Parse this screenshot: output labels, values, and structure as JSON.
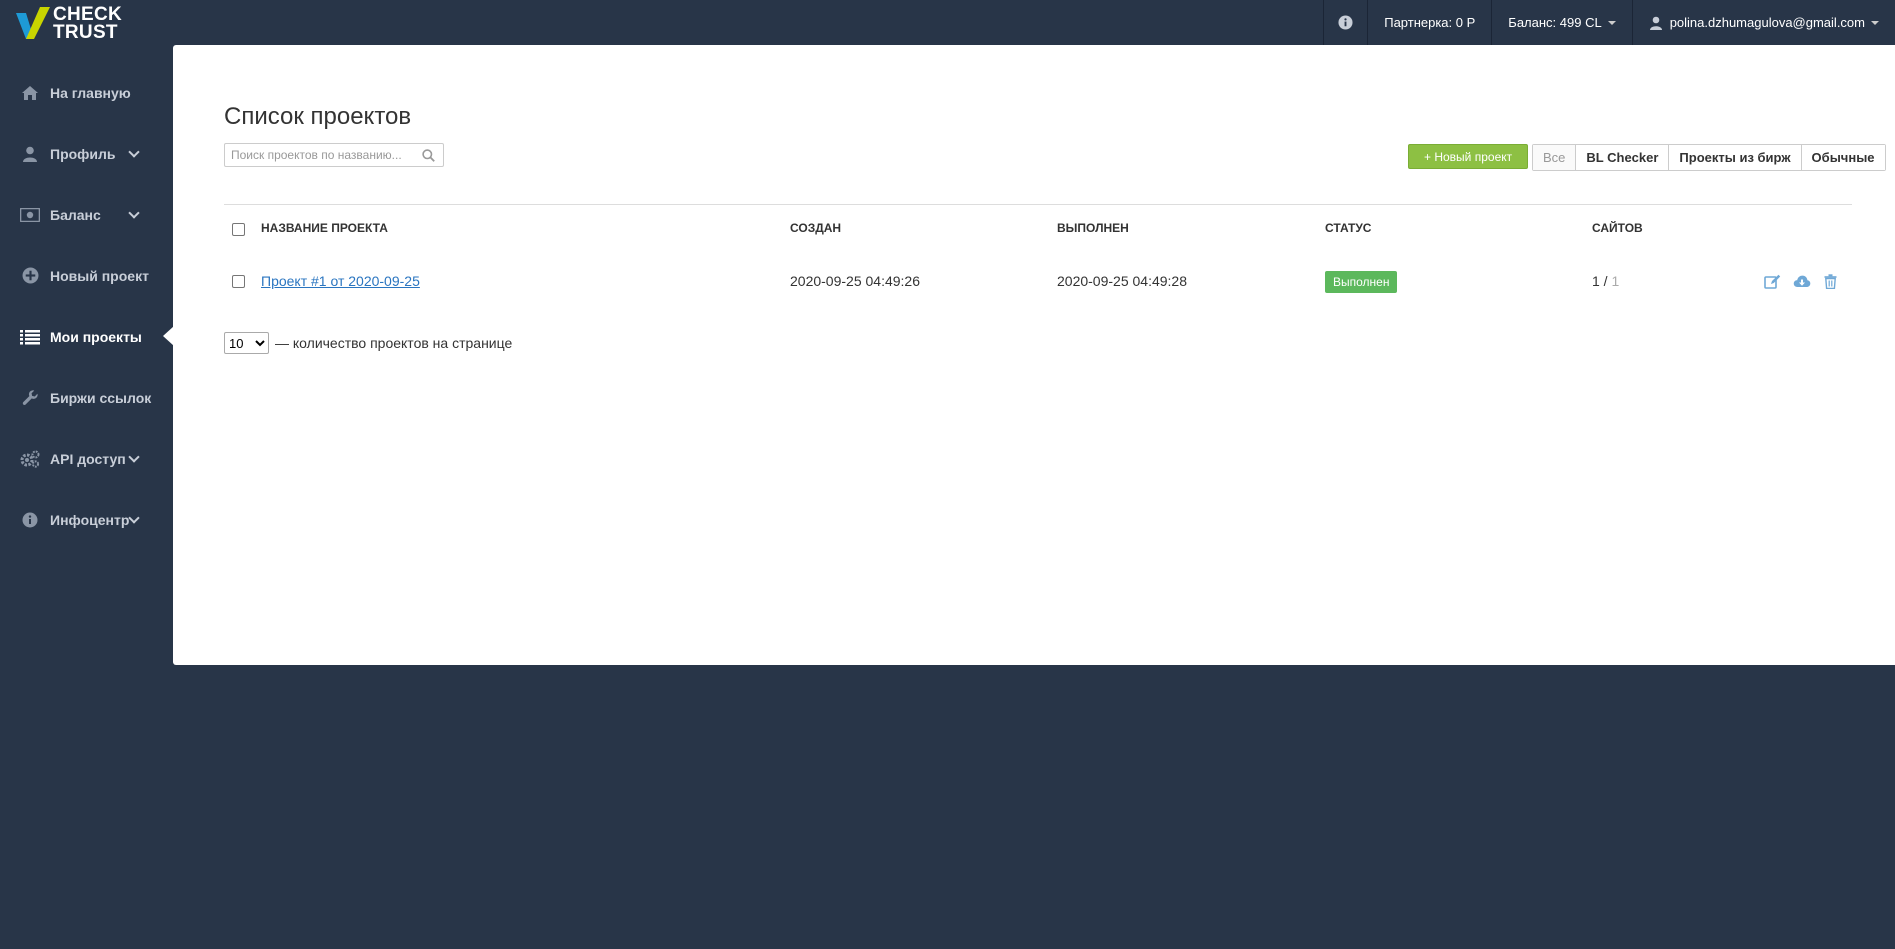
{
  "brand": {
    "line1": "CHECK",
    "line2": "TRUST",
    "accent_yellow": "#c8d400",
    "accent_blue": "#1e9ad6"
  },
  "topbar": {
    "info_icon": "info-circle-icon",
    "partner": "Партнерка: 0 Р",
    "balance": "Баланс: 499 CL",
    "user": "polina.dzhumagulova@gmail.com"
  },
  "sidebar": {
    "items": [
      {
        "label": "На главную",
        "icon": "home-icon",
        "has_submenu": false
      },
      {
        "label": "Профиль",
        "icon": "user-icon",
        "has_submenu": true
      },
      {
        "label": "Баланс",
        "icon": "money-icon",
        "has_submenu": true
      },
      {
        "label": "Новый проект",
        "icon": "plus-circle-icon",
        "has_submenu": false
      },
      {
        "label": "Мои проекты",
        "icon": "list-icon",
        "has_submenu": false,
        "active": true
      },
      {
        "label": "Биржи ссылок",
        "icon": "wrench-icon",
        "has_submenu": false
      },
      {
        "label": "API доступ",
        "icon": "gears-icon",
        "has_submenu": true
      },
      {
        "label": "Инфоцентр",
        "icon": "info-icon",
        "has_submenu": true
      }
    ]
  },
  "main": {
    "title": "Список проектов",
    "search_placeholder": "Поиск проектов по названию...",
    "new_project_button": "+ Новый проект",
    "filters": [
      "Все",
      "BL Checker",
      "Проекты из бирж",
      "Обычные"
    ],
    "columns": {
      "name": "НАЗВАНИЕ ПРОЕКТА",
      "created": "СОЗДАН",
      "done": "ВЫПОЛНЕН",
      "status": "СТАТУС",
      "sites": "САЙТОВ"
    },
    "rows": [
      {
        "name": "Проект #1 от 2020-09-25",
        "created": "2020-09-25 04:49:26",
        "done": "2020-09-25 04:49:28",
        "status": "Выполнен",
        "sites_done": "1 /",
        "sites_total": "1"
      }
    ],
    "per_page_value": "10",
    "per_page_options": [
      "10"
    ],
    "per_page_label": "— количество проектов на странице"
  },
  "colors": {
    "background": "#283548",
    "green_button": "#8dc043",
    "status_green": "#5cb85c",
    "link_blue": "#2a75c0",
    "icon_blue": "#6fa8d6"
  }
}
